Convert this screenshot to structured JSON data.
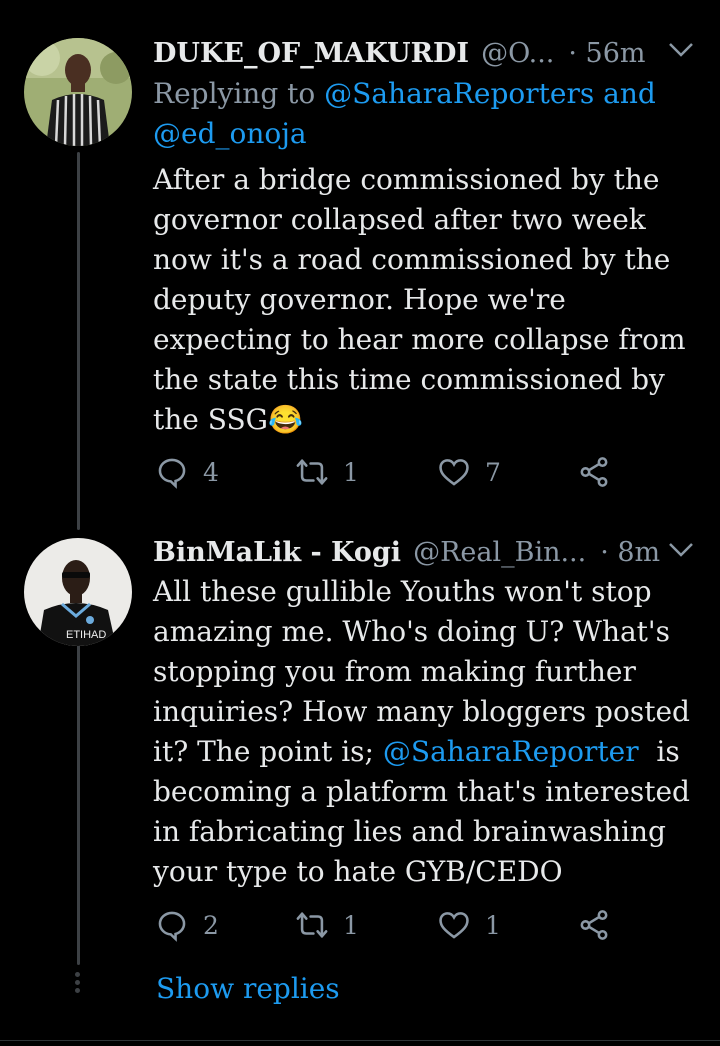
{
  "tweets": [
    {
      "name": "DUKE_OF_MAKURDI",
      "handle": "@O...",
      "time": "· 56m",
      "reply_prefix": "Replying to ",
      "reply_users_line1": "@SaharaReporters and",
      "reply_users_line2": "@ed_onoja",
      "text": "After a bridge commissioned by the governor collapsed after two week now it's a road commissioned by the deputy governor. Hope we're expecting to hear more collapse from the state this time commissioned by the SSG😂",
      "reply_count": "4",
      "retweet_count": "1",
      "like_count": "7"
    },
    {
      "name": "BinMaLik - Kogi",
      "handle": "@Real_Bin...",
      "time": "· 8m",
      "text_part1": "All these gullible Youths won't stop amazing me. Who's doing U? What's stopping you from making further inquiries? How many bloggers posted it? The point is; ",
      "mention": "@SaharaReporter",
      "text_part2": "  is becoming a platform that's interested in fabricating lies and brainwashing your type to hate GYB/CEDO",
      "avatar_shirt_text": "ETIHAD",
      "reply_count": "2",
      "retweet_count": "1",
      "like_count": "1"
    }
  ],
  "show_replies_label": "Show replies",
  "icons": {
    "reply": "reply-icon",
    "retweet": "retweet-icon",
    "like": "heart-icon",
    "share": "share-icon",
    "more": "chevron-down-icon"
  },
  "colors": {
    "background": "#000000",
    "text": "#e7e9ea",
    "muted": "#8b98a5",
    "link": "#1d9bf0"
  }
}
